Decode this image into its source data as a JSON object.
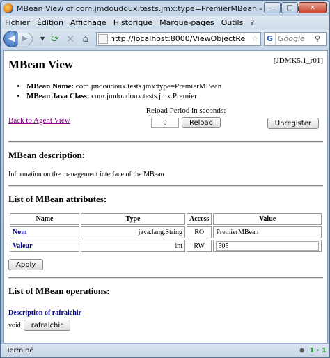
{
  "window": {
    "title": "MBean View of com.jmdoudoux.tests.jmx:type=PremierMBean - Mozilla Firefox"
  },
  "menu": [
    "Fichier",
    "Édition",
    "Affichage",
    "Historique",
    "Marque-pages",
    "Outils",
    "?"
  ],
  "nav": {
    "url": "http://localhost:8000/ViewObjectRe",
    "search_engine": "G",
    "search_placeholder": "Google"
  },
  "page": {
    "title": "MBean View",
    "version": "[JDMK5.1_r01]",
    "mbean_name_label": "MBean Name:",
    "mbean_name": "com.jmdoudoux.tests.jmx:type=PremierMBean",
    "java_class_label": "MBean Java Class:",
    "java_class": "com.jmdoudoux.tests.jmx.Premier",
    "reload_label": "Reload Period in seconds:",
    "reload_value": "0",
    "reload_button": "Reload",
    "back_link": "Back to Agent View",
    "unregister_button": "Unregister",
    "description_heading": "MBean description:",
    "description": "Information on the management interface of the MBean",
    "attributes_heading": "List of MBean attributes:",
    "attr_columns": {
      "name": "Name",
      "type": "Type",
      "access": "Access",
      "value": "Value"
    },
    "attributes": [
      {
        "name": "Nom",
        "type": "java.lang.String",
        "access": "RO",
        "value": "PremierMBean"
      },
      {
        "name": "Valeur",
        "type": "int",
        "access": "RW",
        "value": "505"
      }
    ],
    "apply_button": "Apply",
    "operations_heading": "List of MBean operations:",
    "operation_link": "Description of rafraichir",
    "operation_return": "void",
    "operation_button": "rafraichir"
  },
  "status": {
    "text": "Terminé",
    "counter": "1 · 1"
  }
}
